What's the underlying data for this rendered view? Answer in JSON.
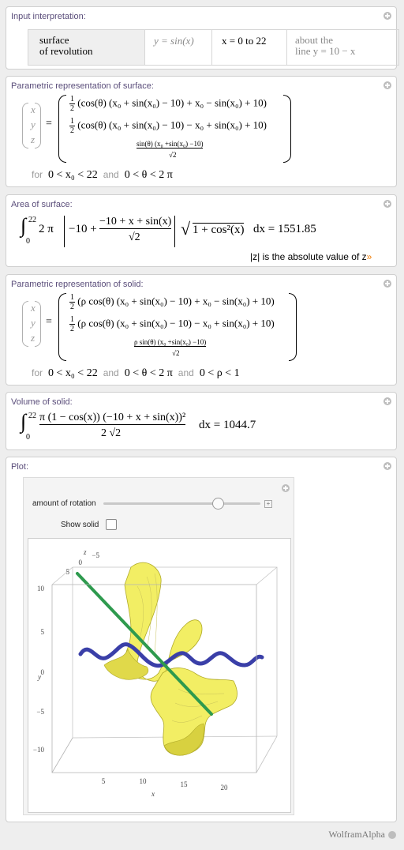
{
  "pods": {
    "input": {
      "title": "Input interpretation:",
      "cells": [
        "surface\nof revolution",
        "y = sin(x)",
        "x = 0 to 22",
        "about the\nline y = 10 − x"
      ]
    },
    "param_surface": {
      "title": "Parametric representation of surface:",
      "vars": [
        "x",
        "y",
        "z"
      ],
      "rows": [
        "(cos(θ) (x₀ + sin(x₀) − 10) + x₀ − sin(x₀) + 10)",
        "(cos(θ) (x₀ + sin(x₀) − 10) − x₀ + sin(x₀) + 10)"
      ],
      "row3_num": "sin(θ) (x₀ +sin(x₀) −10)",
      "row3_den": "√2",
      "half": [
        "1",
        "2"
      ],
      "cond": [
        "0 < x₀ < 22",
        "0 < θ < 2 π"
      ],
      "for": "for",
      "and": "and"
    },
    "area": {
      "title": "Area of surface:",
      "integral": "∫",
      "upper": "22",
      "lower": "0",
      "pre": "2 π",
      "abs_left": "−10 +",
      "frac_num": "−10 + x + sin(x)",
      "frac_den": "√2",
      "sqrt": "1 + cos²(x)",
      "tail": "dx = 1551.85",
      "note": "|z| is the absolute value of z",
      "note_arrow": "»"
    },
    "param_solid": {
      "title": "Parametric representation of solid:",
      "vars": [
        "x",
        "y",
        "z"
      ],
      "rows": [
        "(ρ cos(θ) (x₀ + sin(x₀) − 10) + x₀ − sin(x₀) + 10)",
        "(ρ cos(θ) (x₀ + sin(x₀) − 10) − x₀ + sin(x₀) + 10)"
      ],
      "row3_num": "ρ sin(θ) (x₀ +sin(x₀) −10)",
      "row3_den": "√2",
      "half": [
        "1",
        "2"
      ],
      "cond": [
        "0 < x₀ < 22",
        "0 < θ < 2 π",
        "0 < ρ < 1"
      ],
      "for": "for",
      "and": "and"
    },
    "volume": {
      "title": "Volume of solid:",
      "integral": "∫",
      "upper": "22",
      "lower": "0",
      "frac_num": "π (1 − cos(x)) (−10 + x + sin(x))²",
      "frac_den": "2 √2",
      "tail": "dx = 1044.7"
    },
    "plot": {
      "title": "Plot:",
      "rotation_label": "amount of rotation",
      "rotation_value": 0.73,
      "show_solid_label": "Show solid",
      "show_solid_checked": false,
      "axes": {
        "x_label": "x",
        "y_label": "y",
        "z_label": "z",
        "x_ticks": [
          "5",
          "10",
          "15",
          "20"
        ],
        "y_ticks": [
          "10",
          "5",
          "0",
          "−5",
          "−10"
        ],
        "z_ticks": [
          "5",
          "0",
          "−5"
        ]
      }
    }
  },
  "footer": {
    "brand": "WolframAlpha"
  },
  "colors": {
    "surface_yellow": "#f2ee64",
    "curve_blue": "#3a3fa8",
    "axis_line_green": "#2e9a4e",
    "title_purple": "#5a4d7a"
  }
}
